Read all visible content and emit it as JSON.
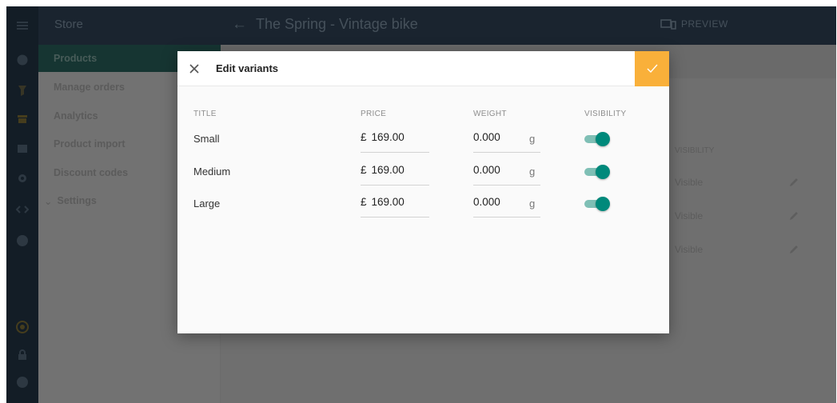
{
  "topbar": {
    "store_label": "Store",
    "page_title": "The Spring - Vintage bike",
    "preview_label": "PREVIEW"
  },
  "nav": {
    "items": [
      {
        "label": "Products",
        "active": true
      },
      {
        "label": "Manage orders"
      },
      {
        "label": "Analytics"
      },
      {
        "label": "Product import"
      },
      {
        "label": "Discount codes"
      },
      {
        "label": "Settings",
        "expandable": true
      }
    ]
  },
  "background_table": {
    "visibility_header": "VISIBILITY",
    "rows": [
      "Visible",
      "Visible",
      "Visible"
    ]
  },
  "dialog": {
    "title": "Edit variants",
    "columns": {
      "title": "TITLE",
      "price": "PRICE",
      "weight": "WEIGHT",
      "visibility": "VISIBILITY"
    },
    "currency": "£",
    "weight_unit": "g",
    "variants": [
      {
        "title": "Small",
        "price": "169.00",
        "weight": "0.000",
        "visible": true
      },
      {
        "title": "Medium",
        "price": "169.00",
        "weight": "0.000",
        "visible": true
      },
      {
        "title": "Large",
        "price": "169.00",
        "weight": "0.000",
        "visible": true
      }
    ]
  },
  "colors": {
    "rail": "#263a4d",
    "topbar": "#34495e",
    "confirm_accent": "#f9b03a",
    "toggle_on": "#00897b"
  },
  "icons": [
    "menu-icon",
    "globe-icon",
    "pin-icon",
    "store-icon",
    "mail-icon",
    "gear-icon",
    "code-icon",
    "help-icon",
    "shield-icon",
    "lock-icon",
    "account-icon",
    "back-arrow-icon",
    "preview-devices-icon",
    "close-icon",
    "check-icon",
    "edit-icon"
  ]
}
